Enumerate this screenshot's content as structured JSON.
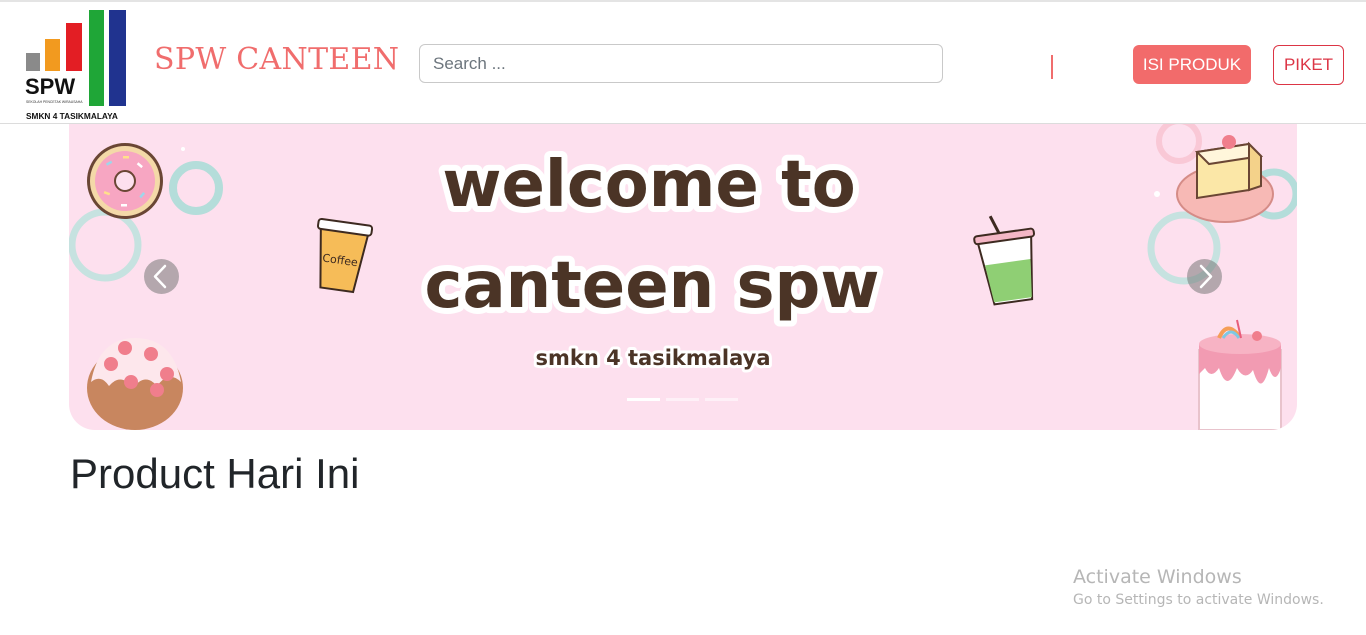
{
  "navbar": {
    "logo": {
      "text": "SPW",
      "tagline": "SEKOLAH PENCETAK WIRAUSAHA",
      "school": "SMKN 4 TASIKMALAYA"
    },
    "brand": "SPW CANTEEN",
    "search": {
      "placeholder": "Search ..."
    },
    "buttons": {
      "isi_produk": "ISI PRODUK",
      "piket": "PIKET"
    }
  },
  "carousel": {
    "slide": {
      "line1": "welcome to",
      "line2": "canteen spw",
      "subtitle": "smkn 4 tasikmalaya",
      "cup_label": "Coffee"
    },
    "slide_count": 3,
    "active_index": 0
  },
  "main": {
    "section_title": "Product Hari Ini"
  },
  "watermark": {
    "title": "Activate Windows",
    "subtitle": "Go to Settings to activate Windows."
  },
  "colors": {
    "brand": "#f06d6d",
    "banner_bg": "#fde0ee",
    "banner_text": "#4b3426",
    "danger": "#dc3545"
  }
}
